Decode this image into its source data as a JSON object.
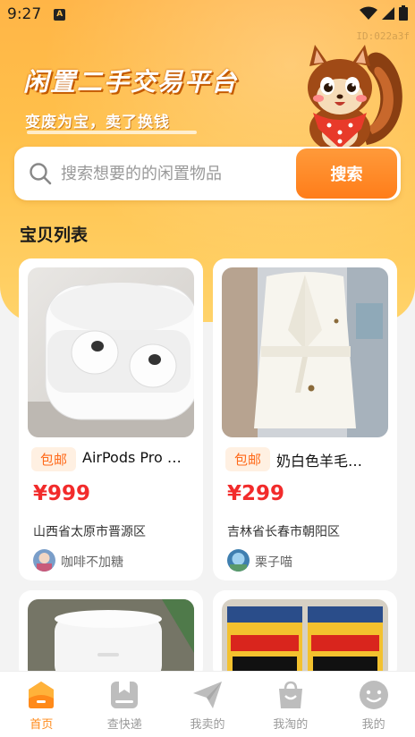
{
  "status": {
    "time": "9:27",
    "notification_glyph": "A"
  },
  "watermark": "ID:022a3f",
  "hero": {
    "title": "闲置二手交易平台",
    "subtitle": "变废为宝，卖了换钱"
  },
  "search": {
    "placeholder": "搜索想要的的闲置物品",
    "button_label": "搜索"
  },
  "section_title": "宝贝列表",
  "products": [
    {
      "tag": "包邮",
      "title": "AirPods Pro …",
      "price": "¥999",
      "location": "山西省太原市晋源区",
      "user": "咖啡不加糖"
    },
    {
      "tag": "包邮",
      "title": "奶白色羊毛…",
      "price": "¥299",
      "location": "吉林省长春市朝阳区",
      "user": "栗子喵"
    }
  ],
  "tabbar": {
    "items": [
      {
        "label": "首页",
        "icon": "home-icon",
        "active": true
      },
      {
        "label": "查快递",
        "icon": "parcel-icon",
        "active": false
      },
      {
        "label": "我卖的",
        "icon": "paper-plane-icon",
        "active": false
      },
      {
        "label": "我淘的",
        "icon": "shopping-bag-icon",
        "active": false
      },
      {
        "label": "我的",
        "icon": "smiley-icon",
        "active": false
      }
    ]
  },
  "colors": {
    "accent": "#ff8a1a",
    "price": "#f22b2b",
    "hero": "#ffc04a"
  }
}
